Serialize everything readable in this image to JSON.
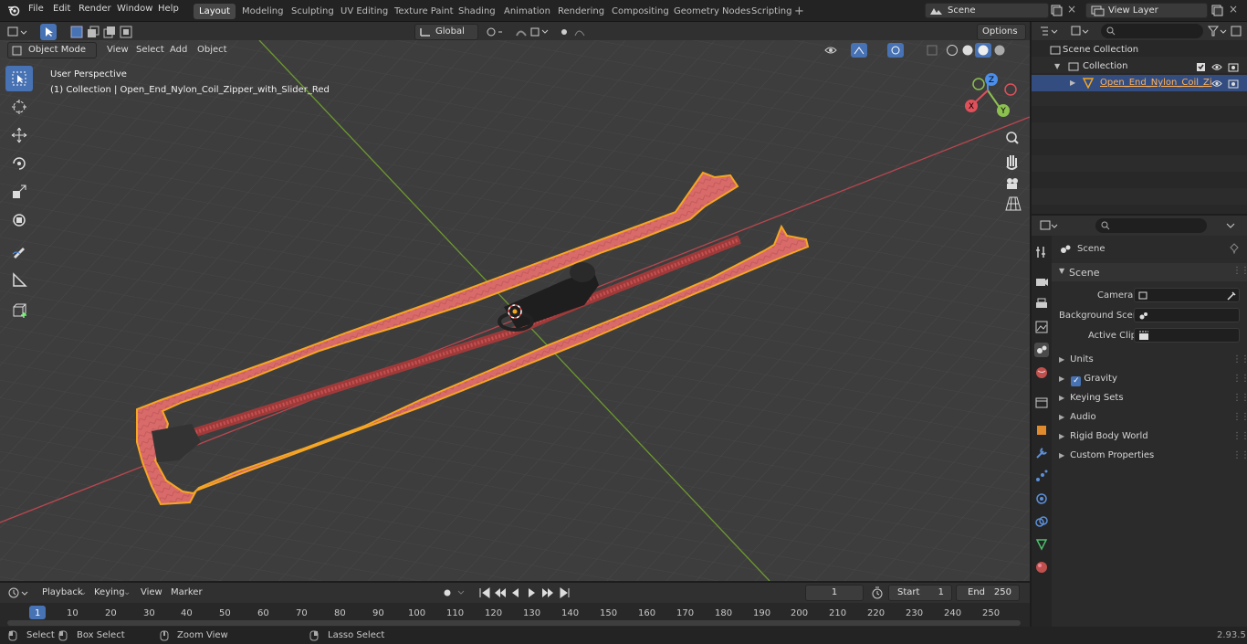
{
  "menus": [
    "File",
    "Edit",
    "Render",
    "Window",
    "Help"
  ],
  "workspaces": [
    {
      "label": "Layout",
      "active": true
    },
    {
      "label": "Modeling"
    },
    {
      "label": "Sculpting"
    },
    {
      "label": "UV Editing"
    },
    {
      "label": "Texture Paint"
    },
    {
      "label": "Shading"
    },
    {
      "label": "Animation"
    },
    {
      "label": "Rendering"
    },
    {
      "label": "Compositing"
    },
    {
      "label": "Geometry Nodes"
    },
    {
      "label": "Scripting"
    }
  ],
  "scene_field": "Scene",
  "view_layer_field": "View Layer",
  "viewport": {
    "mode": "Object Mode",
    "menus": [
      "View",
      "Select",
      "Add",
      "Object"
    ],
    "transform_orientation": "Global",
    "options_label": "Options",
    "overlay_title": "User Perspective",
    "overlay_subtitle": "(1) Collection | Open_End_Nylon_Coil_Zipper_with_Slider_Red",
    "gizmo": {
      "z": "Z",
      "y": "Y",
      "x": "X"
    }
  },
  "outliner": {
    "rows": [
      {
        "label": "Scene Collection"
      },
      {
        "label": "Collection"
      },
      {
        "label": "Open_End_Nylon_Coil_Zi"
      }
    ]
  },
  "properties": {
    "breadcrumb": "Scene",
    "section": "Scene",
    "fields": [
      {
        "label": "Camera"
      },
      {
        "label": "Background Scene"
      },
      {
        "label": "Active Clip"
      }
    ],
    "panels": [
      "Units",
      "Gravity",
      "Keying Sets",
      "Audio",
      "Rigid Body World",
      "Custom Properties"
    ]
  },
  "timeline": {
    "menus": [
      "Playback",
      "Keying",
      "View",
      "Marker"
    ],
    "current_frame": "1",
    "start_label": "Start",
    "start_value": "1",
    "end_label": "End",
    "end_value": "250",
    "ticks": [
      "1",
      "10",
      "20",
      "30",
      "40",
      "50",
      "60",
      "70",
      "80",
      "90",
      "100",
      "110",
      "120",
      "130",
      "140",
      "150",
      "160",
      "170",
      "180",
      "190",
      "200",
      "210",
      "220",
      "230",
      "240",
      "250"
    ]
  },
  "statusbar": {
    "select": "Select",
    "box_select": "Box Select",
    "zoom_view": "Zoom View",
    "lasso_select": "Lasso Select",
    "version": "2.93.5"
  },
  "colors": {
    "accent": "#4772b3",
    "selection_outline": "#f5a623",
    "zipper": "#d96a6a",
    "x_axis": "#b8474f",
    "y_axis": "#6d9a2e"
  }
}
